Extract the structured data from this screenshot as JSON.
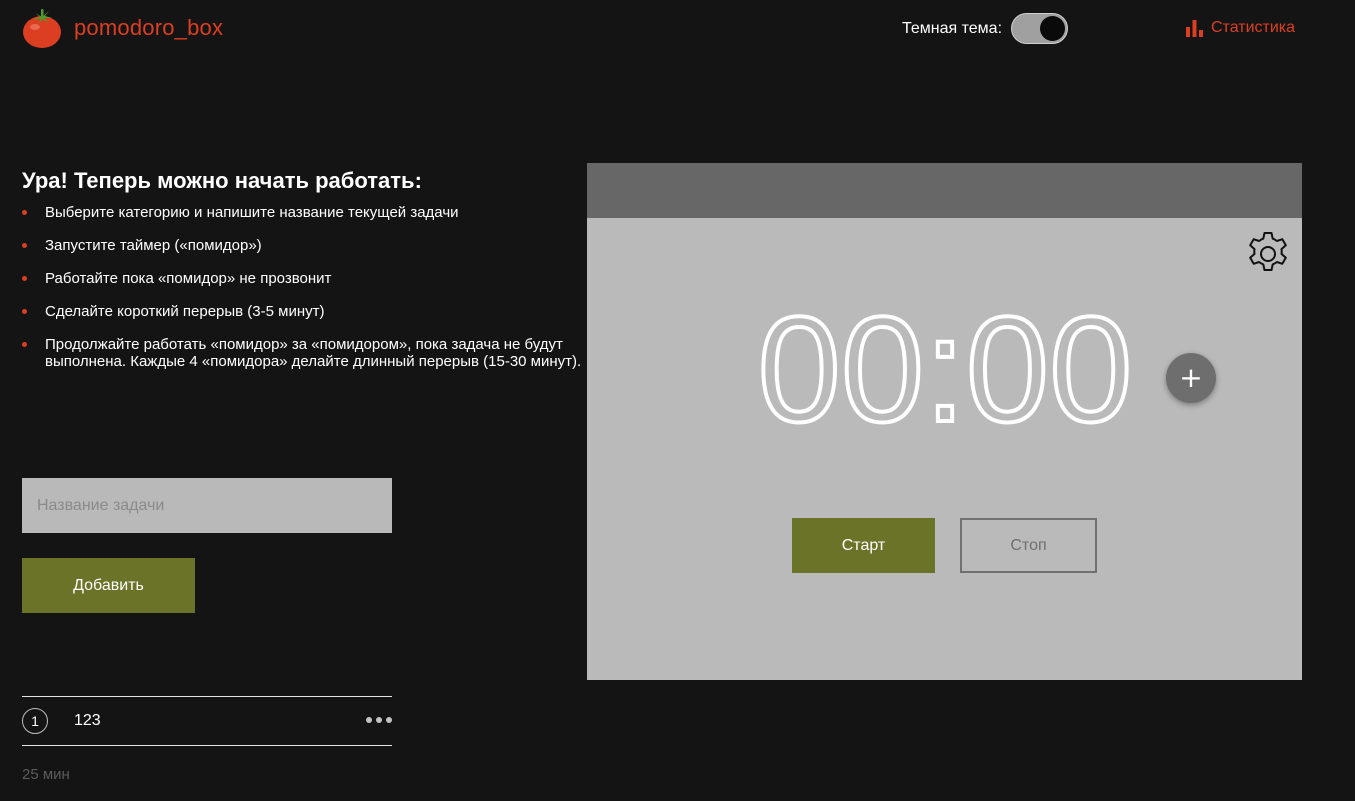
{
  "header": {
    "app_name": "pomodoro_box",
    "theme_label": "Темная тема:",
    "dark_theme_enabled": true,
    "stats_label": "Статистика"
  },
  "instructions": {
    "title": "Ура! Теперь можно начать работать:",
    "steps": [
      "Выберите категорию и напишите название текущей задачи",
      "Запустите таймер («помидор»)",
      "Работайте пока «помидор» не прозвонит",
      "Сделайте короткий перерыв (3-5 минут)",
      "Продолжайте работать «помидор» за «помидором», пока задача не будут выполнена. Каждые 4 «помидора» делайте длинный перерыв (15-30 минут)."
    ]
  },
  "task_form": {
    "input_value": "",
    "input_placeholder": "Название задачи",
    "add_label": "Добавить"
  },
  "tasks": [
    {
      "count": "1",
      "name": "123"
    }
  ],
  "total_time": "25 мин",
  "timer": {
    "time": "00:00",
    "plus_label": "+",
    "start_label": "Старт",
    "stop_label": "Стоп"
  },
  "colors": {
    "accent_red": "#dc3e22",
    "button_green": "#6b7329",
    "background": "#141414",
    "card": "#bababa",
    "card_header": "#676767"
  },
  "icons": {
    "logo": "tomato-icon",
    "stats": "bar-chart-icon",
    "settings": "gear-icon",
    "task_menu": "more-horizontal-icon"
  }
}
